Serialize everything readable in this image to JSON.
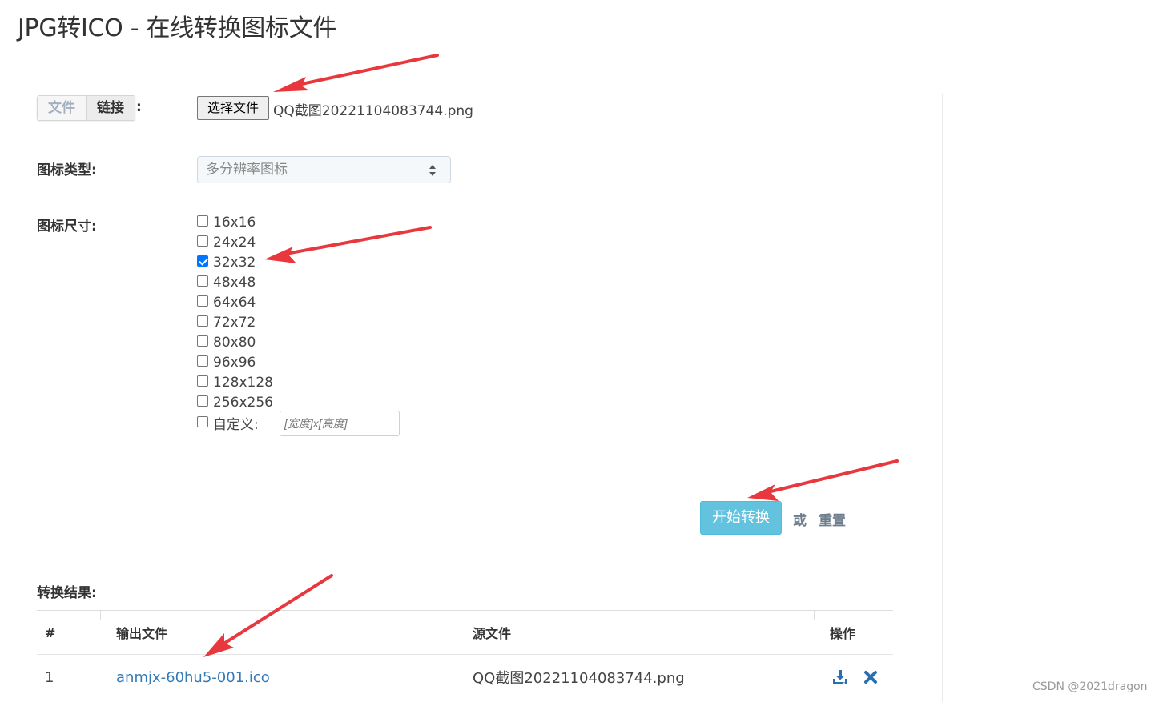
{
  "page": {
    "title": "JPG转ICO - 在线转换图标文件"
  },
  "source": {
    "tabs": [
      {
        "label": "文件",
        "active": true
      },
      {
        "label": "链接",
        "active": false
      }
    ],
    "colon": ":",
    "file_button_label": "选择文件",
    "file_name": "QQ截图20221104083744.png"
  },
  "icon_type": {
    "label": "图标类型:",
    "selected": "多分辨率图标"
  },
  "icon_size": {
    "label": "图标尺寸:",
    "options": [
      {
        "label": "16x16",
        "checked": false
      },
      {
        "label": "24x24",
        "checked": false
      },
      {
        "label": "32x32",
        "checked": true
      },
      {
        "label": "48x48",
        "checked": false
      },
      {
        "label": "64x64",
        "checked": false
      },
      {
        "label": "72x72",
        "checked": false
      },
      {
        "label": "80x80",
        "checked": false
      },
      {
        "label": "96x96",
        "checked": false
      },
      {
        "label": "128x128",
        "checked": false
      },
      {
        "label": "256x256",
        "checked": false
      }
    ],
    "custom_label": "自定义:",
    "custom_placeholder": "[宽度]x[高度]"
  },
  "actions": {
    "convert_label": "开始转换",
    "or_label": "或",
    "reset_label": "重置",
    "convert_color": "#5bc0de"
  },
  "results": {
    "title": "转换结果:",
    "headers": [
      "#",
      "输出文件",
      "源文件",
      "操作"
    ],
    "rows": [
      {
        "index": "1",
        "output": "anmjx-60hu5-001.ico",
        "source": "QQ截图20221104083744.png",
        "actions": [
          "download-icon",
          "delete-icon"
        ]
      }
    ]
  },
  "watermark": "CSDN @2021dragon",
  "annotation_color": "#e8383d"
}
